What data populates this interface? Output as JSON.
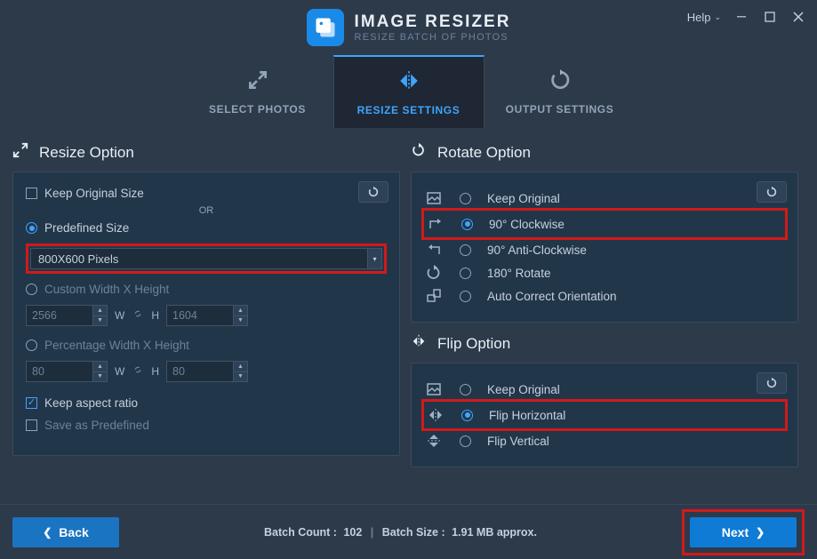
{
  "brand": {
    "title": "IMAGE RESIZER",
    "subtitle": "RESIZE BATCH OF PHOTOS"
  },
  "titlebar": {
    "help": "Help"
  },
  "tabs": {
    "select_photos": "SELECT PHOTOS",
    "resize_settings": "RESIZE SETTINGS",
    "output_settings": "OUTPUT SETTINGS"
  },
  "resize": {
    "title": "Resize Option",
    "keep_original": "Keep Original Size",
    "or": "OR",
    "predefined_label": "Predefined Size",
    "predefined_value": "800X600 Pixels",
    "custom_label": "Custom Width X Height",
    "custom_w": "2566",
    "custom_h": "1604",
    "percent_label": "Percentage Width X Height",
    "percent_w": "80",
    "percent_h": "80",
    "w": "W",
    "h": "H",
    "keep_aspect": "Keep aspect ratio",
    "save_predef": "Save as Predefined"
  },
  "rotate": {
    "title": "Rotate Option",
    "keep": "Keep Original",
    "cw": "90° Clockwise",
    "acw": "90° Anti-Clockwise",
    "r180": "180° Rotate",
    "auto": "Auto Correct Orientation"
  },
  "flip": {
    "title": "Flip Option",
    "keep": "Keep Original",
    "h": "Flip Horizontal",
    "v": "Flip Vertical"
  },
  "footer": {
    "back": "Back",
    "next": "Next",
    "batch_count_label": "Batch Count :",
    "batch_count": "102",
    "batch_size_label": "Batch Size :",
    "batch_size": "1.91 MB approx."
  }
}
